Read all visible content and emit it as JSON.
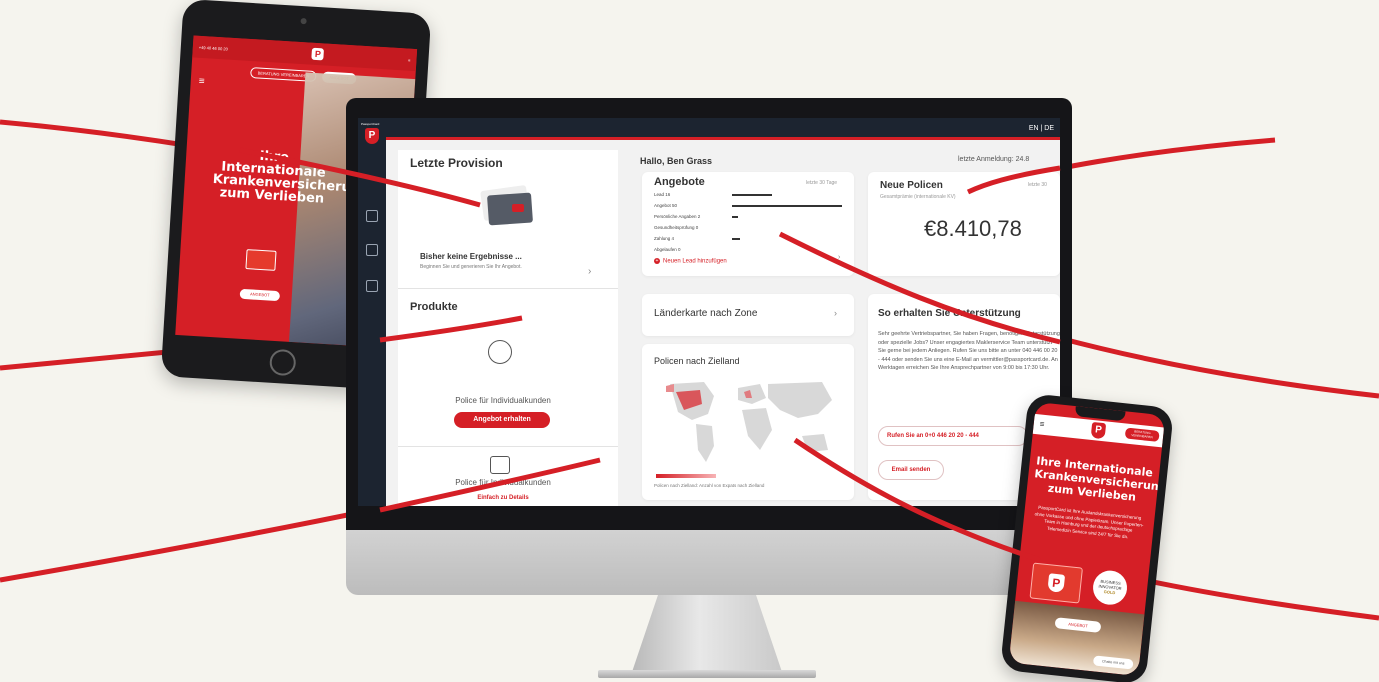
{
  "colors": {
    "brand_red": "#d51f26",
    "nav_dark": "#1c2430",
    "background": "#f5f4ee"
  },
  "tablet": {
    "top_phone": "+49 40 46 00 20",
    "btn_left": "BERATUNG VEREINBAREN",
    "btn_right": "ANGEBOT",
    "headline": "Ihre Internationale Krankenversicherung zum Verlieben",
    "cta": "ANGEBOT"
  },
  "dashboard": {
    "lang": "EN | DE",
    "left_panel": {
      "title": "Letzte Provision",
      "empty_title": "Bisher keine Ergebnisse ...",
      "empty_subtitle": "Beginnen Sie und generieren Sie Ihr Angebot.",
      "products_title": "Produkte",
      "product1_label": "Police für Individualkunden",
      "product1_button": "Angebot erhalten",
      "product2_label": "Police für Individualkunden",
      "product2_link": "Einfach zu Details"
    },
    "greeting": "Hallo, Ben Grass",
    "last_login": "letzte Anmeldung: 24.8",
    "offers": {
      "title": "Angebote",
      "period": "letzte 30 Tage",
      "rows": [
        "Lead 16",
        "Angebot 50",
        "Persönliche Angaben 2",
        "Gesundheitsprüfung 0",
        "Zahlung 4",
        "Abgelaufen 0"
      ],
      "new_lead": "Neuen Lead hinzufügen"
    },
    "new_policies": {
      "title": "Neue Policen",
      "subtitle": "Gesamtprämie (internationale KV)",
      "period": "letzte 30",
      "amount": "€8.410,78"
    },
    "country_map": {
      "title": "Länderkarte nach Zone"
    },
    "policies_map": {
      "title": "Policen nach Zielland",
      "caption": "Policen nach Zielland: Anzahl von Expats nach Zielland"
    },
    "support": {
      "title": "So erhalten Sie Unterstützung",
      "text": "Sehr geehrte Vertriebspartner, Sie haben Fragen, benötigen Unterstützung oder spezielle Jobs? Unser engagiertes Maklerservice Team unterstützt Sie gerne bei jedem Anliegen. Rufen Sie uns bitte an unter 040 446 00 20 - 444 oder senden Sie uns eine E-Mail an vermittler@passportcard.de. An Werktagen erreichen Sie Ihre Ansprechpartner von 9:00 bis 17:30 Uhr.",
      "call_button": "Rufen Sie an 0+0 446 20 20 - 444",
      "mail_button": "Email senden"
    }
  },
  "phone": {
    "top_button": "BERATUNG VEREINBAREN",
    "headline": "Ihre Internationale Krankenversicherung zum Verlieben",
    "subtext": "PassportCard ist Ihre Auslandskrankenversicherung ohne Vorkasse und ohne Papierkram. Unser Experten-Team in Hamburg und der deutschsprachige Telemedizin Service sind 24/7 für Sie da.",
    "badge_top": "BUSINESS INNOVATOR",
    "badge_gold": "GOLD",
    "cta": "ANGEBOT",
    "chat": "Chatte mit uns"
  }
}
